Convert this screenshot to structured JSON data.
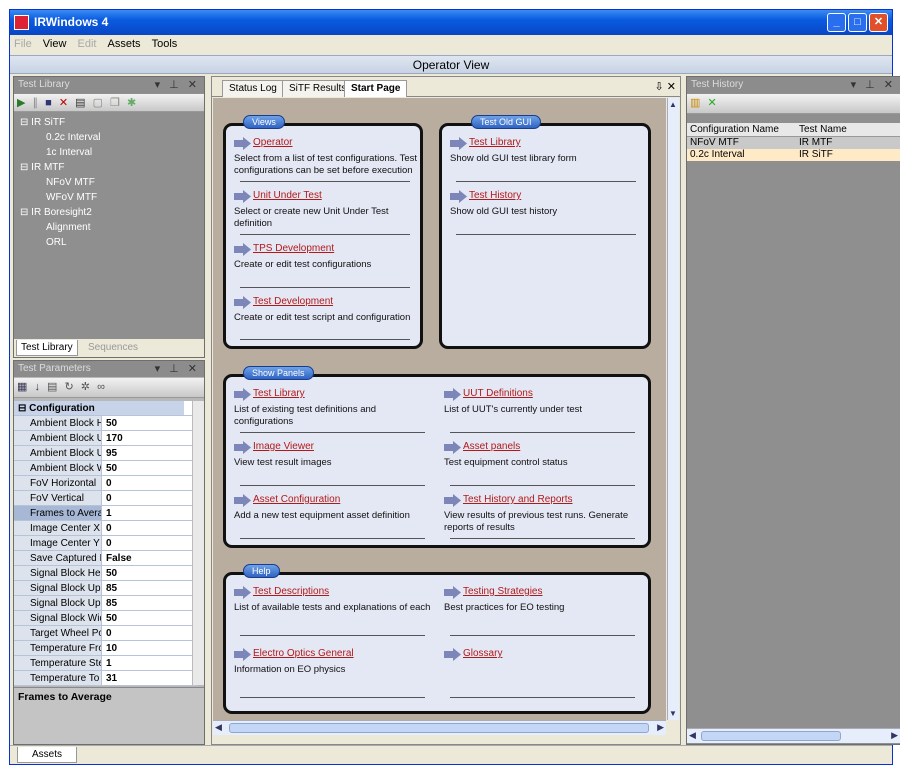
{
  "window": {
    "title": "IRWindows 4"
  },
  "menu": [
    {
      "label": "File",
      "enabled": false
    },
    {
      "label": "View",
      "enabled": true
    },
    {
      "label": "Edit",
      "enabled": false
    },
    {
      "label": "Assets",
      "enabled": true
    },
    {
      "label": "Tools",
      "enabled": true
    }
  ],
  "header": {
    "title": "Operator View"
  },
  "test_library": {
    "title": "Test Library",
    "tree": [
      {
        "label": "IR SiTF",
        "children": [
          "0.2c Interval",
          "1c Interval"
        ]
      },
      {
        "label": "IR MTF",
        "children": [
          "NFoV MTF",
          "WFoV MTF"
        ]
      },
      {
        "label": "IR Boresight2",
        "children": [
          "Alignment",
          "ORL"
        ]
      }
    ],
    "tabs": [
      "Test Library",
      "Sequences"
    ]
  },
  "test_parameters": {
    "title": "Test Parameters",
    "category": "Configuration",
    "rows": [
      {
        "name": "Ambient Block He",
        "value": "50"
      },
      {
        "name": "Ambient Block Up",
        "value": "170"
      },
      {
        "name": "Ambient Block Up",
        "value": "95"
      },
      {
        "name": "Ambient Block Wi",
        "value": "50"
      },
      {
        "name": "FoV Horizontal",
        "value": "0"
      },
      {
        "name": "FoV Vertical",
        "value": "0"
      },
      {
        "name": "Frames to Averag",
        "value": "1"
      },
      {
        "name": "Image Center X",
        "value": "0"
      },
      {
        "name": "Image Center Y",
        "value": "0"
      },
      {
        "name": "Save Captured Im",
        "value": "False"
      },
      {
        "name": "Signal Block Heig",
        "value": "50"
      },
      {
        "name": "Signal Block Uppe",
        "value": "85"
      },
      {
        "name": "Signal Block Uppe",
        "value": "85"
      },
      {
        "name": "Signal Block Widt",
        "value": "50"
      },
      {
        "name": "Target Wheel Pos",
        "value": "0"
      },
      {
        "name": "Temperature Fron",
        "value": "10"
      },
      {
        "name": "Temperature Step",
        "value": "1"
      },
      {
        "name": "Temperature To",
        "value": "31"
      }
    ],
    "description_title": "Frames to Average"
  },
  "center": {
    "tabs": [
      "Status Log",
      "SiTF Results",
      "Start Page"
    ],
    "groups": {
      "views": {
        "badge": "Views",
        "items": [
          {
            "link": "Operator",
            "desc": [
              "Select from a list of test configurations. Test",
              "configurations can be set before execution"
            ]
          },
          {
            "link": "Unit Under Test",
            "desc": [
              "Select or create new Unit Under Test",
              "definition"
            ]
          },
          {
            "link": "TPS Development",
            "desc": [
              "Create or edit test configurations"
            ]
          },
          {
            "link": "Test Development",
            "desc": [
              "Create or edit test script and configuration"
            ]
          }
        ]
      },
      "old_gui": {
        "badge": "Test Old GUI",
        "items": [
          {
            "link": "Test Library",
            "desc": [
              "Show old GUI test library form"
            ]
          },
          {
            "link": "Test History",
            "desc": [
              "Show old GUI test history"
            ]
          }
        ]
      },
      "show_panels": {
        "badge": "Show Panels",
        "items": [
          {
            "link": "Test Library",
            "desc": [
              "List of existing test definitions and configurations"
            ]
          },
          {
            "link": "UUT Definitions",
            "desc": [
              "List of UUT's currently under test"
            ]
          },
          {
            "link": "Image Viewer",
            "desc": [
              "View test result images"
            ]
          },
          {
            "link": "Asset panels",
            "desc": [
              "Test equipment control status"
            ]
          },
          {
            "link": "Asset Configuration",
            "desc": [
              "Add a new test equipment asset definition"
            ]
          },
          {
            "link": "Test History and Reports",
            "desc": [
              "View results of previous test runs. Generate",
              "reports of results"
            ]
          }
        ]
      },
      "help": {
        "badge": "Help",
        "items": [
          {
            "link": "Test Descriptions",
            "desc": [
              "List of available tests and explanations of each"
            ]
          },
          {
            "link": "Testing Strategies",
            "desc": [
              "Best practices for EO testing"
            ]
          },
          {
            "link": "Electro Optics General",
            "desc": [
              "Information on EO physics"
            ]
          },
          {
            "link": "Glossary",
            "desc": []
          }
        ]
      }
    }
  },
  "test_history": {
    "title": "Test History",
    "columns": [
      "Configuration Name",
      "Test Name"
    ],
    "rows": [
      [
        "NFoV MTF",
        "IR MTF"
      ],
      [
        "0.2c Interval",
        "IR SiTF"
      ]
    ]
  },
  "status": {
    "assets_tab": "Assets"
  },
  "colors": {
    "title_bar": "#0a5be0",
    "group_border": "#111111",
    "link": "#b21a1a",
    "panel_bg": "#8f8f8f",
    "content_bg": "#b8ad9f"
  }
}
